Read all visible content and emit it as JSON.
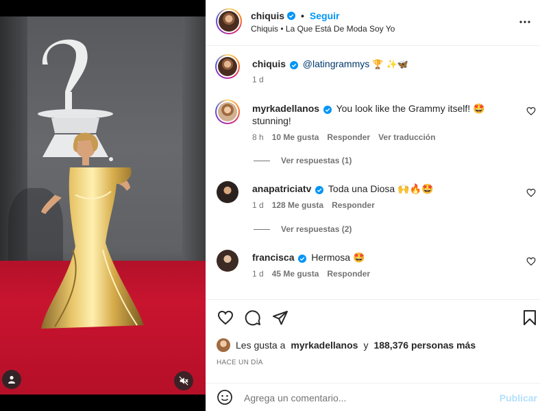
{
  "header": {
    "username": "chiquis",
    "follow_label": "Seguir",
    "separator": "•",
    "subtitle": "Chiquis • La Que Está De Moda Soy Yo"
  },
  "caption": {
    "username": "chiquis",
    "text": "@latingrammys",
    "emojis": "🏆 ✨🦋",
    "time": "1 d"
  },
  "comments": [
    {
      "username": "myrkadellanos",
      "text": "You look like the Grammy itself! 🤩 stunning!",
      "time": "8 h",
      "likes": "10 Me gusta",
      "reply_label": "Responder",
      "translate_label": "Ver traducción",
      "view_replies": "Ver respuestas (1)"
    },
    {
      "username": "anapatriciatv",
      "text": "Toda una Diosa 🙌🔥🤩",
      "time": "1 d",
      "likes": "128 Me gusta",
      "reply_label": "Responder",
      "view_replies": "Ver respuestas (2)"
    },
    {
      "username": "francisca",
      "text": "Hermosa 🤩",
      "time": "1 d",
      "likes": "45 Me gusta",
      "reply_label": "Responder"
    }
  ],
  "likes": {
    "prefix": "Les gusta a",
    "user": "myrkadellanos",
    "joiner": "y",
    "others": "188,376 personas más"
  },
  "time_ago": "HACE UN DÍA",
  "add_comment": {
    "placeholder": "Agrega un comentario...",
    "publish_label": "Publicar"
  },
  "icons": {
    "header_more": "more-horizontal-icon",
    "like": "heart-icon",
    "comment": "comment-icon",
    "share": "share-icon",
    "save": "bookmark-icon",
    "mute": "muted-speaker-icon",
    "tagged": "user-tag-icon",
    "emoji": "emoji-icon",
    "verified": "verified-badge-icon"
  },
  "colors": {
    "accent": "#0095f6",
    "verified": "#0095f6",
    "muted_text": "#737373",
    "publish_disabled": "#b2dffc"
  }
}
